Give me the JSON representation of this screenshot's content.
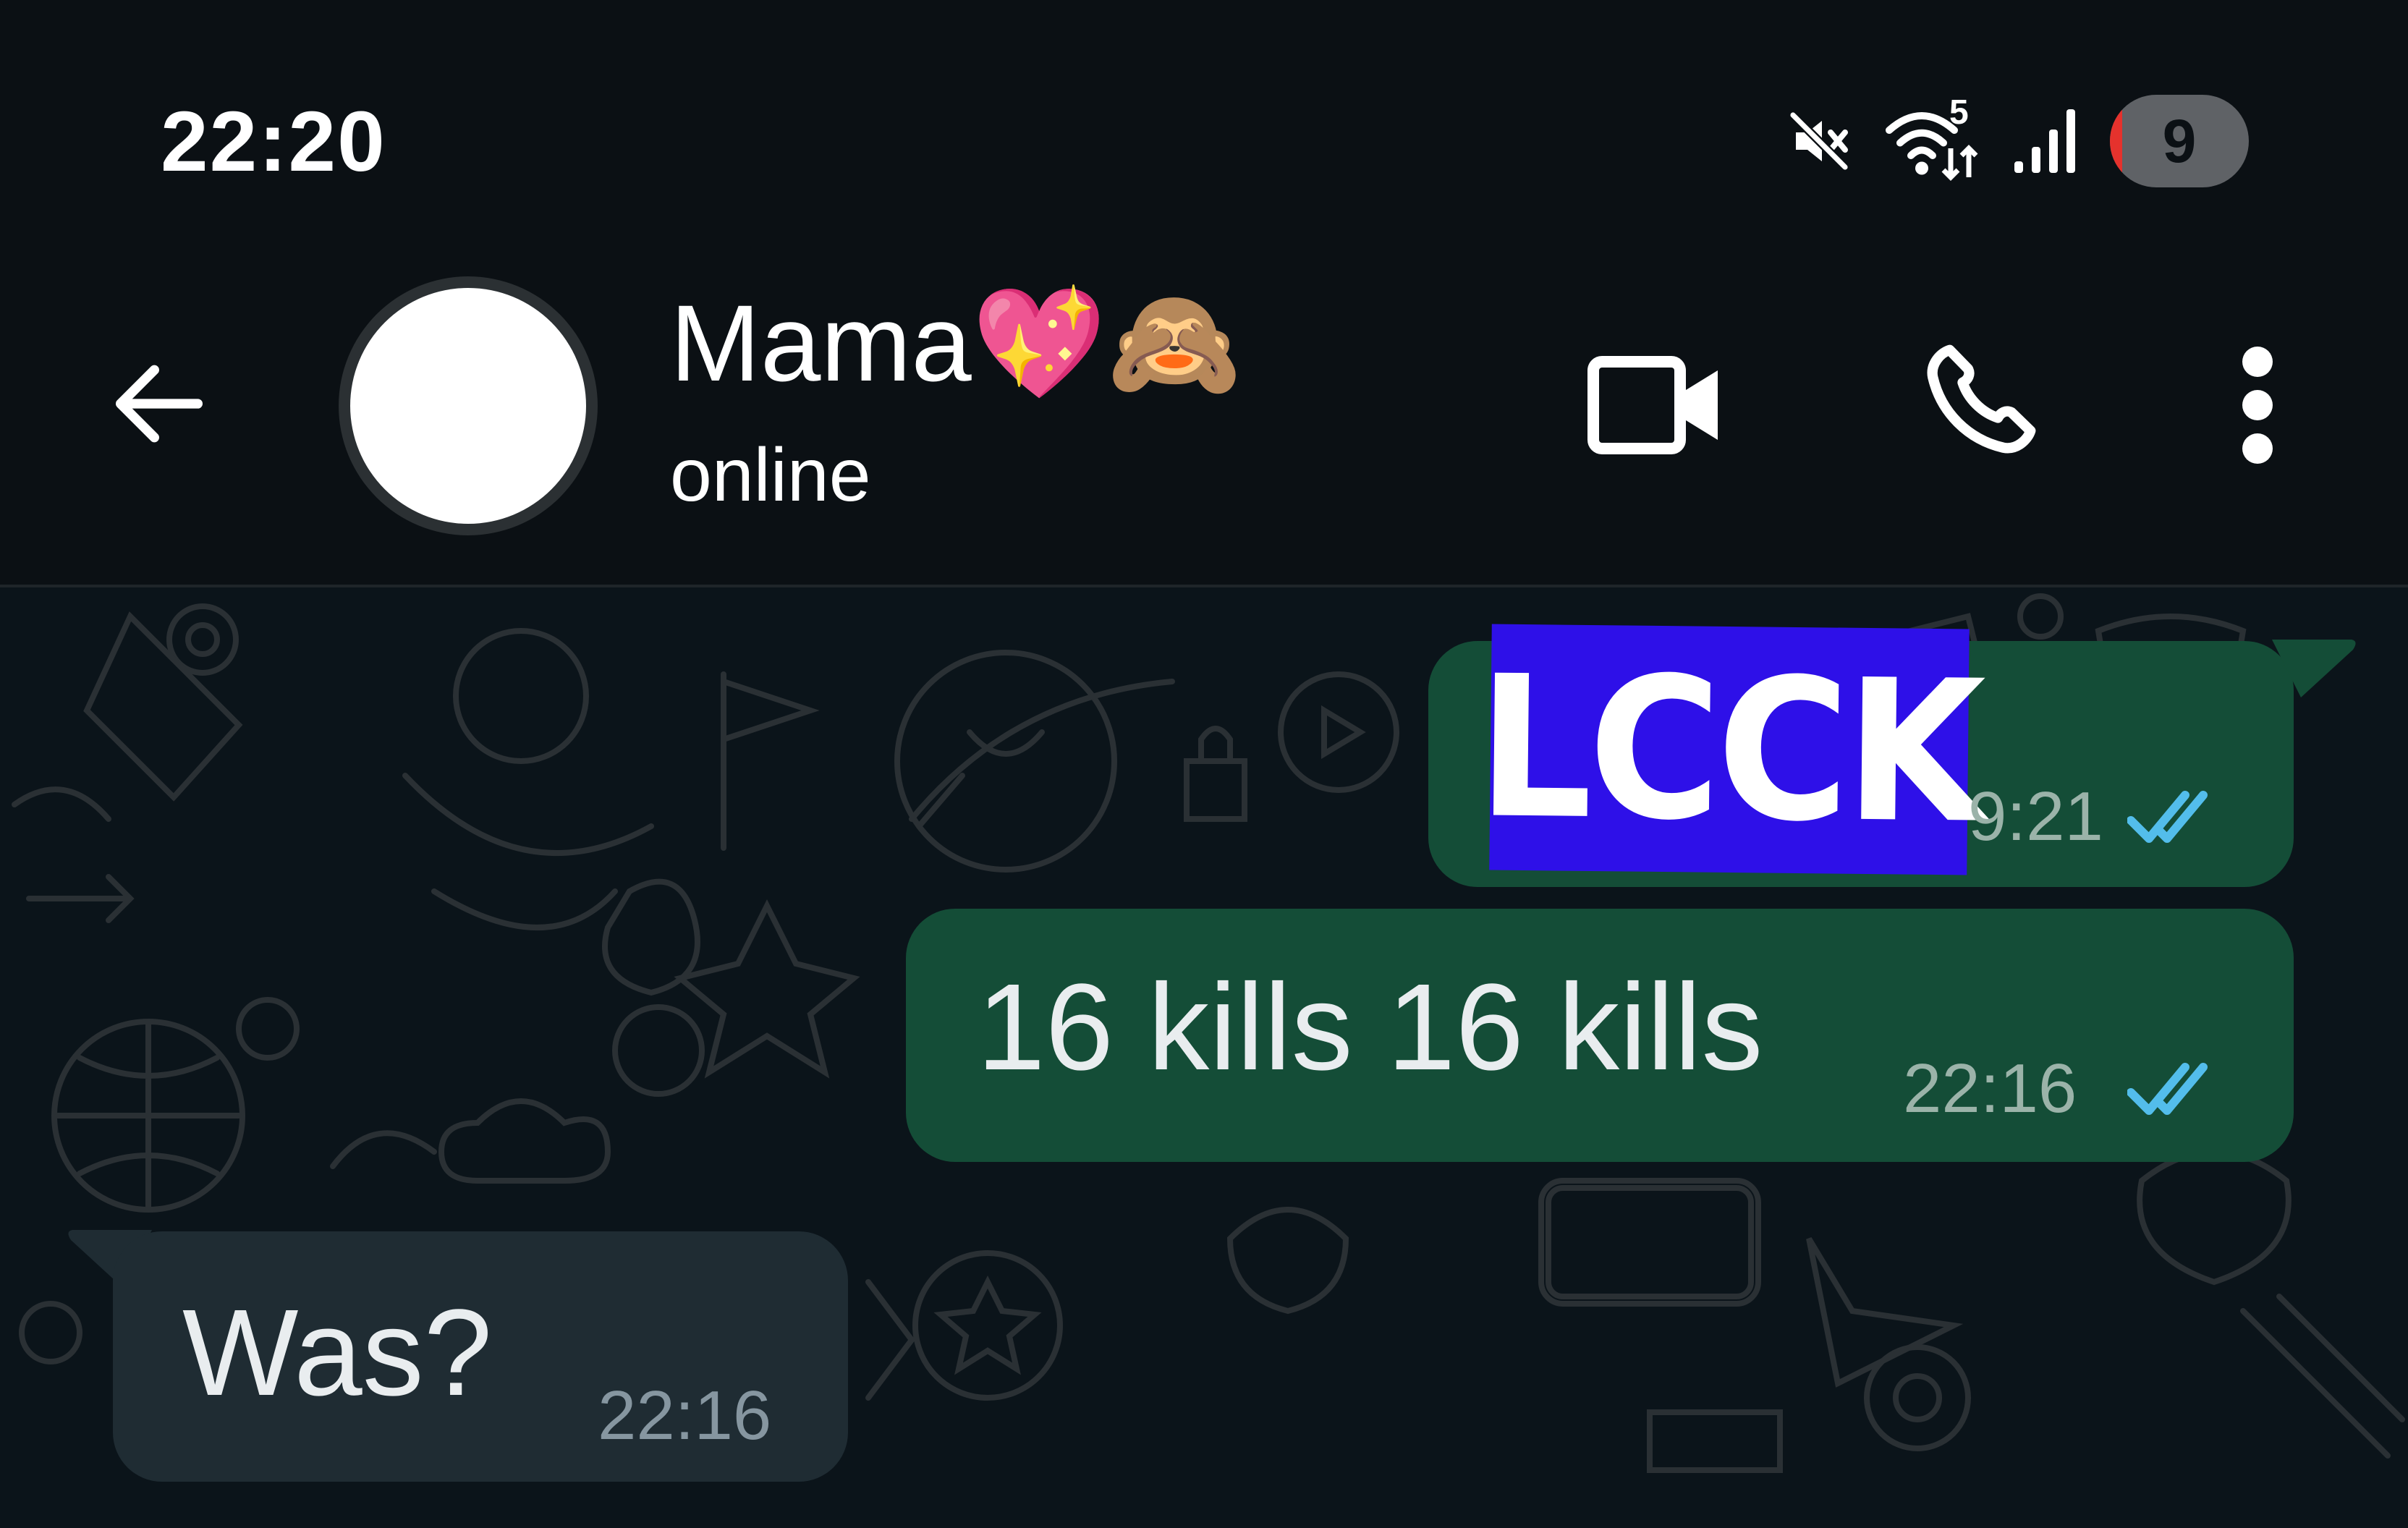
{
  "status_bar": {
    "time": "22:20",
    "wifi_badge": "5",
    "battery_level": "9",
    "battery_fraction": 0.09,
    "icons": [
      "mute-icon",
      "wifi-icon",
      "signal-icon",
      "battery-icon"
    ]
  },
  "header": {
    "contact_name": "Mama💖🙈",
    "contact_status": "online",
    "actions": [
      "back-arrow-icon",
      "video-call-icon",
      "voice-call-icon",
      "more-options-icon"
    ]
  },
  "messages": [
    {
      "direction": "outgoing",
      "type": "sticker",
      "sticker_text": "LCCK",
      "time": "9:21",
      "read": true
    },
    {
      "direction": "outgoing",
      "type": "text",
      "text": "16 kills 16 kills",
      "time": "22:16",
      "read": true
    },
    {
      "direction": "incoming",
      "type": "text",
      "text": "Was?",
      "time": "22:16"
    }
  ],
  "colors": {
    "background": "#0b1014",
    "outgoing_bubble": "#144d37",
    "incoming_bubble": "#1f2c33",
    "read_ticks": "#53bdeb",
    "sticker_bg": "#2e10e8"
  }
}
